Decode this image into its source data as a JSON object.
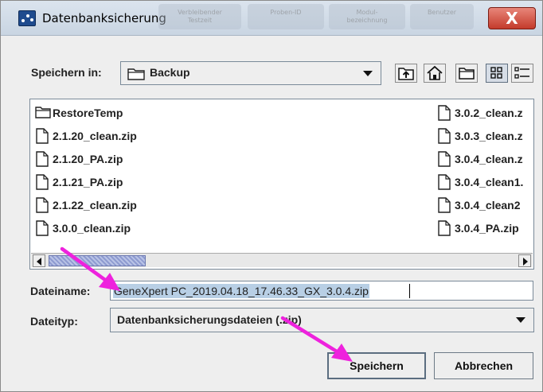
{
  "window": {
    "title": "Datenbanksicherung",
    "close_glyph": "X",
    "ghost_tabs": [
      {
        "line1": "Verbleibender",
        "line2": "Testzeit"
      },
      {
        "line1": "Proben-ID",
        "line2": ""
      },
      {
        "line1": "Modul-",
        "line2": "bezeichnung"
      },
      {
        "line1": "Benutzer",
        "line2": ""
      }
    ]
  },
  "save_in": {
    "label": "Speichern in:",
    "value": "Backup"
  },
  "toolbar": {
    "icons": [
      "up-folder-icon",
      "home-icon",
      "new-folder-icon",
      "list-view-icon",
      "details-view-icon"
    ]
  },
  "files": {
    "left_column": [
      {
        "name": "RestoreTemp",
        "type": "folder"
      },
      {
        "name": "2.1.20_clean.zip",
        "type": "file"
      },
      {
        "name": "2.1.20_PA.zip",
        "type": "file"
      },
      {
        "name": "2.1.21_PA.zip",
        "type": "file"
      },
      {
        "name": "2.1.22_clean.zip",
        "type": "file"
      },
      {
        "name": "3.0.0_clean.zip",
        "type": "file"
      }
    ],
    "right_column": [
      {
        "name": "3.0.2_clean.z",
        "type": "file"
      },
      {
        "name": "3.0.3_clean.z",
        "type": "file"
      },
      {
        "name": "3.0.4_clean.z",
        "type": "file"
      },
      {
        "name": "3.0.4_clean1.",
        "type": "file"
      },
      {
        "name": "3.0.4_clean2",
        "type": "file"
      },
      {
        "name": "3.0.4_PA.zip",
        "type": "file"
      }
    ]
  },
  "filename": {
    "label": "Dateiname:",
    "value": "GeneXpert PC_2019.04.18_17.46.33_GX_3.0.4.zip"
  },
  "filetype": {
    "label": "Dateityp:",
    "value": "Datenbanksicherungsdateien (.zip)"
  },
  "buttons": {
    "save": "Speichern",
    "cancel": "Abbrechen"
  },
  "annotation_color": "#ee22dd"
}
